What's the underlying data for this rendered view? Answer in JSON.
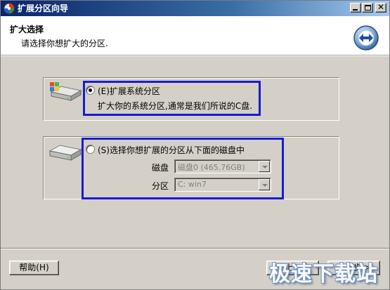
{
  "window": {
    "title": "扩展分区向导",
    "controls": {
      "minimize": "minimize",
      "maximize": "maximize",
      "close": "✕"
    }
  },
  "header": {
    "title": "扩大选择",
    "subtitle": "请选择你想扩大的分区.",
    "icon": "back-forward-arrows-icon"
  },
  "options": {
    "system": {
      "label": "(E)扩展系统分区",
      "description": "扩大你的系统分区,通常是我们所说的C盘.",
      "selected": true
    },
    "other": {
      "label": "(S)选择你想扩展的分区从下面的磁盘中",
      "selected": false,
      "disk_label": "磁盘",
      "disk_value": "磁盘0 (465.76GB)",
      "partition_label": "分区",
      "partition_value": "C: win7"
    }
  },
  "footer": {
    "help_label": "帮助(H)",
    "back_label": "< 上一步",
    "next_label": "下一步 >"
  },
  "watermark": "极速下载站",
  "colors": {
    "highlight_border": "#1a1ad6",
    "titlebar_start": "#0a246a",
    "titlebar_end": "#a6caf0",
    "dialog_bg": "#d4d0c8"
  }
}
